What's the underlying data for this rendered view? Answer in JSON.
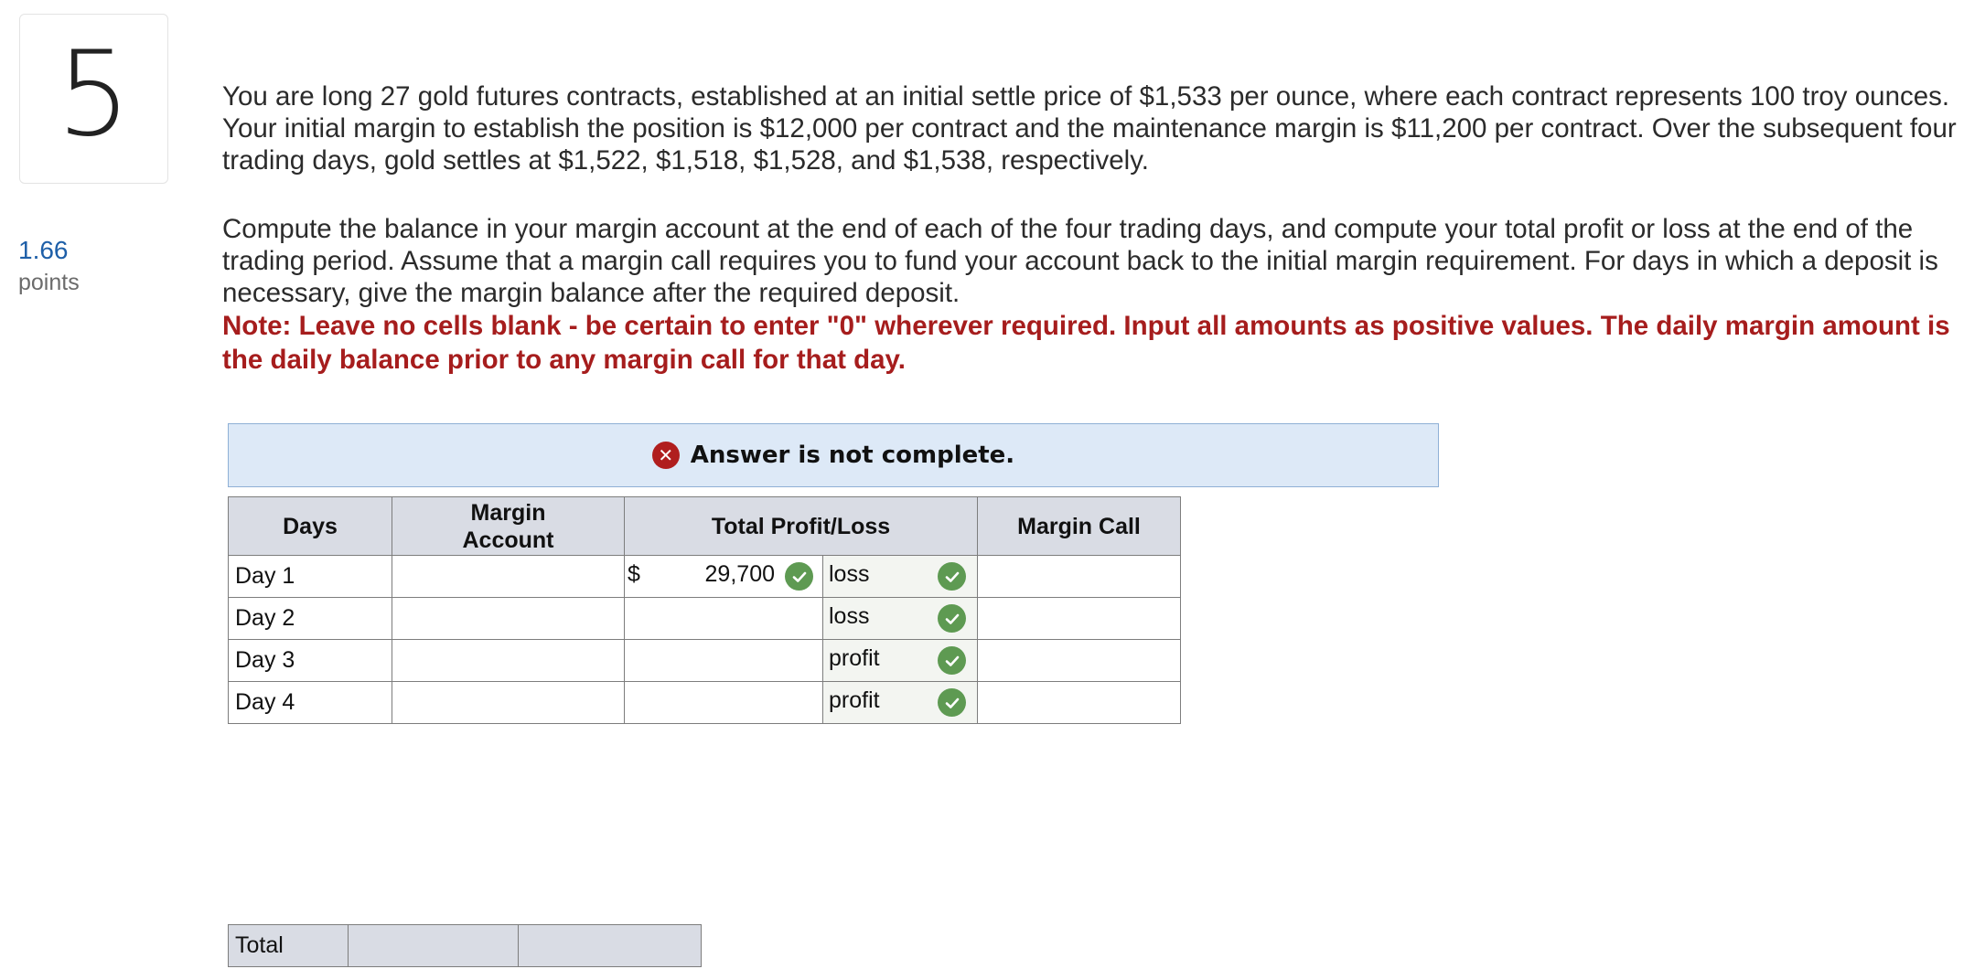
{
  "question": {
    "number": "5",
    "points_value": "1.66",
    "points_label": "points",
    "paragraph1": "You are long 27 gold futures contracts, established at an initial settle price of $1,533 per ounce, where each contract represents 100 troy ounces. Your initial margin to establish the position is $12,000 per contract and the maintenance margin is $11,200 per contract. Over the subsequent four trading days, gold settles at $1,522, $1,518, $1,528, and $1,538, respectively.",
    "paragraph2": "Compute the balance in your margin account at the end of each of the four trading days, and compute your total profit or loss at the end of the trading period. Assume that a margin call requires you to fund your account back to the initial margin requirement. For days in which a deposit is necessary, give the margin balance after the required deposit.",
    "note": "Note: Leave no cells blank - be certain to enter \"0\" wherever required. Input all amounts as positive values. The daily margin amount is the daily balance prior to any margin call for that day."
  },
  "banner": {
    "text": "Answer is not complete.",
    "icon": "x-circle-icon",
    "color": "#b01e1e"
  },
  "table": {
    "headers": {
      "days": "Days",
      "margin_account": "Margin Account",
      "total_pl": "Total Profit/Loss",
      "margin_call": "Margin Call"
    },
    "rows": [
      {
        "day": "Day 1",
        "margin_account": "",
        "pl_dollar": "$",
        "pl_value": "29,700",
        "pl_value_correct": true,
        "pl_type": "loss",
        "pl_type_correct": true,
        "margin_call": ""
      },
      {
        "day": "Day 2",
        "margin_account": "",
        "pl_dollar": "",
        "pl_value": "",
        "pl_value_correct": false,
        "pl_type": "loss",
        "pl_type_correct": true,
        "margin_call": ""
      },
      {
        "day": "Day 3",
        "margin_account": "",
        "pl_dollar": "",
        "pl_value": "",
        "pl_value_correct": false,
        "pl_type": "profit",
        "pl_type_correct": true,
        "margin_call": ""
      },
      {
        "day": "Day 4",
        "margin_account": "",
        "pl_dollar": "",
        "pl_value": "",
        "pl_value_correct": false,
        "pl_type": "profit",
        "pl_type_correct": true,
        "margin_call": ""
      }
    ]
  },
  "total_row": {
    "label": "Total",
    "cell2": "",
    "cell3": ""
  },
  "colors": {
    "points": "#1e5fa8",
    "note": "#a61d1d",
    "check": "#5e9a52",
    "header_bg": "#d9dce4",
    "banner_bg": "#dde9f7"
  }
}
